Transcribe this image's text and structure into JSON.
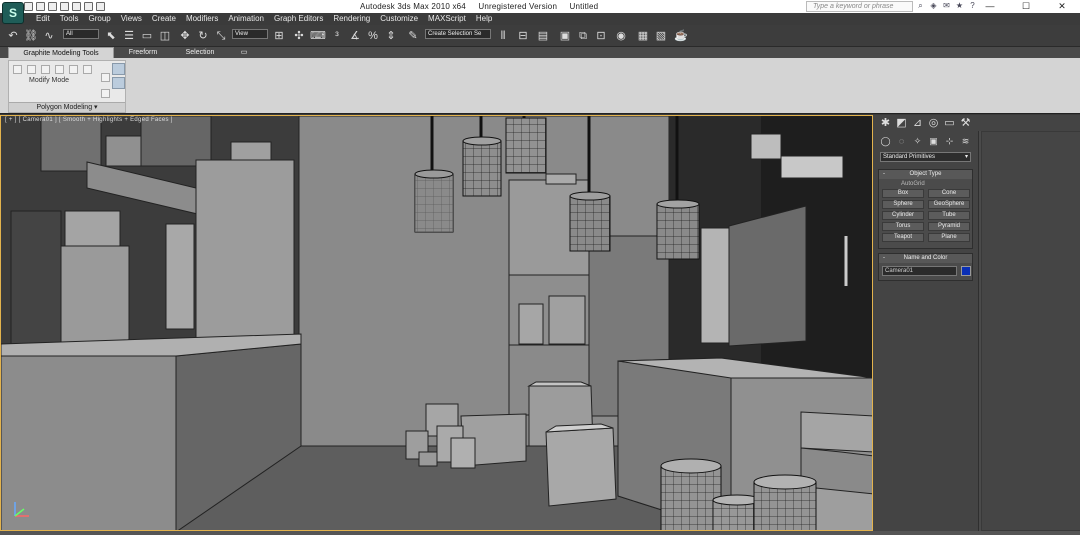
{
  "window": {
    "app_title": "Autodesk 3ds Max  2010 x64",
    "status": "Unregistered Version",
    "doc_title": "Untitled",
    "search_placeholder": "Type a keyword or phrase",
    "controls": [
      "—",
      "☐",
      "✕"
    ]
  },
  "menu": [
    "Edit",
    "Tools",
    "Group",
    "Views",
    "Create",
    "Modifiers",
    "Animation",
    "Graph Editors",
    "Rendering",
    "Customize",
    "MAXScript",
    "Help"
  ],
  "toolbar": {
    "filter_value": "All",
    "refcoord_value": "View",
    "selection_set_placeholder": "Create Selection Se"
  },
  "ribbon": {
    "tabs": [
      "Graphite Modeling Tools",
      "Freeform",
      "Selection"
    ],
    "modify_mode": "Modify Mode",
    "polygon_modeling": "Polygon Modeling"
  },
  "viewport": {
    "label": "[ + ] [ Camera01 ] [ Smooth + Highlights + Edged Faces ]",
    "border_color": "#e3b34d"
  },
  "command_panel": {
    "category_value": "Standard Primitives",
    "object_type_header": "Object Type",
    "autogrid_label": "AutoGrid",
    "primitives": [
      "Box",
      "Cone",
      "Sphere",
      "GeoSphere",
      "Cylinder",
      "Tube",
      "Torus",
      "Pyramid",
      "Teapot",
      "Plane"
    ],
    "name_color_header": "Name and Color",
    "object_name": "Camera01",
    "object_color": "#0a2fb5"
  }
}
